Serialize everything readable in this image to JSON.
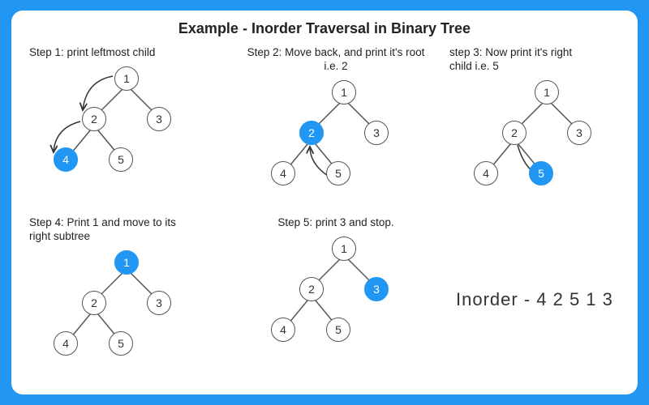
{
  "title": "Example - Inorder Traversal in Binary Tree",
  "steps": {
    "s1": {
      "caption": "Step 1: print leftmost child"
    },
    "s2": {
      "caption": "Step 2: Move back, and print it's root\ni.e. 2"
    },
    "s3": {
      "caption": "step 3: Now print it's right\nchild i.e. 5"
    },
    "s4": {
      "caption": "Step 4: Print 1 and move to its\nright subtree"
    },
    "s5": {
      "caption": "Step 5: print 3 and stop."
    }
  },
  "nodes": {
    "n1": "1",
    "n2": "2",
    "n3": "3",
    "n4": "4",
    "n5": "5"
  },
  "result": "Inorder -  4 2 5 1 3",
  "colors": {
    "accent": "#2196f3"
  }
}
